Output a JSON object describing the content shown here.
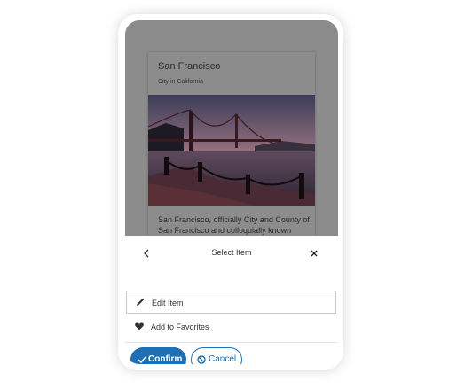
{
  "card": {
    "title": "San Francisco",
    "subtitle": "City in California",
    "description": "San Francisco, officially City and County of San Francisco and colloquially known",
    "image_icon": "golden-gate-bridge-photo"
  },
  "sheet": {
    "title": "Select Item",
    "back_icon": "chevron-left-icon",
    "close_icon": "close-icon",
    "items": [
      {
        "label": "Edit Item",
        "icon": "pencil-icon",
        "selected": true
      },
      {
        "label": "Add to Favorites",
        "icon": "heart-icon",
        "selected": false
      }
    ]
  },
  "actions": {
    "confirm_label": "Confirm",
    "confirm_icon": "check-icon",
    "cancel_label": "Cancel",
    "cancel_icon": "block-icon"
  },
  "colors": {
    "primary": "#1f6fb5",
    "overlay": "#8c8c8c",
    "surface": "#ffffff"
  }
}
